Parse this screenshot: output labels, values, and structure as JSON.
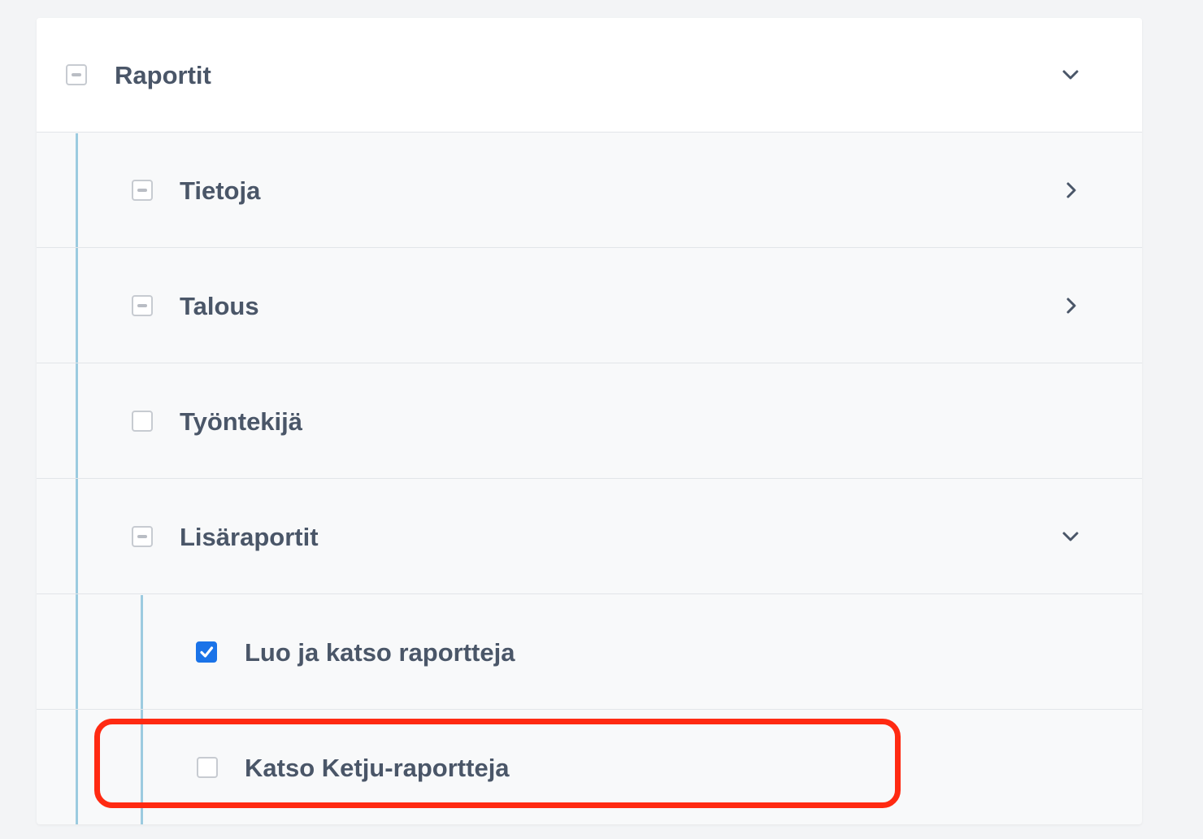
{
  "permissions": {
    "root": {
      "label": "Raportit",
      "state": "indeterminate",
      "expanded": true,
      "chevron": "chevron-down-icon"
    },
    "items": [
      {
        "label": "Tietoja",
        "state": "indeterminate",
        "chevron": "chevron-right-icon"
      },
      {
        "label": "Talous",
        "state": "indeterminate",
        "chevron": "chevron-right-icon"
      },
      {
        "label": "Työntekijä",
        "state": "unchecked"
      },
      {
        "label": "Lisäraportit",
        "state": "indeterminate",
        "expanded": true,
        "chevron": "chevron-down-icon",
        "children": [
          {
            "label": "Luo ja katso raportteja",
            "state": "checked"
          },
          {
            "label": "Katso Ketju-raportteja",
            "state": "unchecked",
            "highlighted": true
          }
        ]
      }
    ]
  },
  "colors": {
    "text": "#4a5668",
    "checkbox_checked": "#1a73e8",
    "tree_line": "#9ccbe0",
    "highlight": "#ff2a12"
  }
}
